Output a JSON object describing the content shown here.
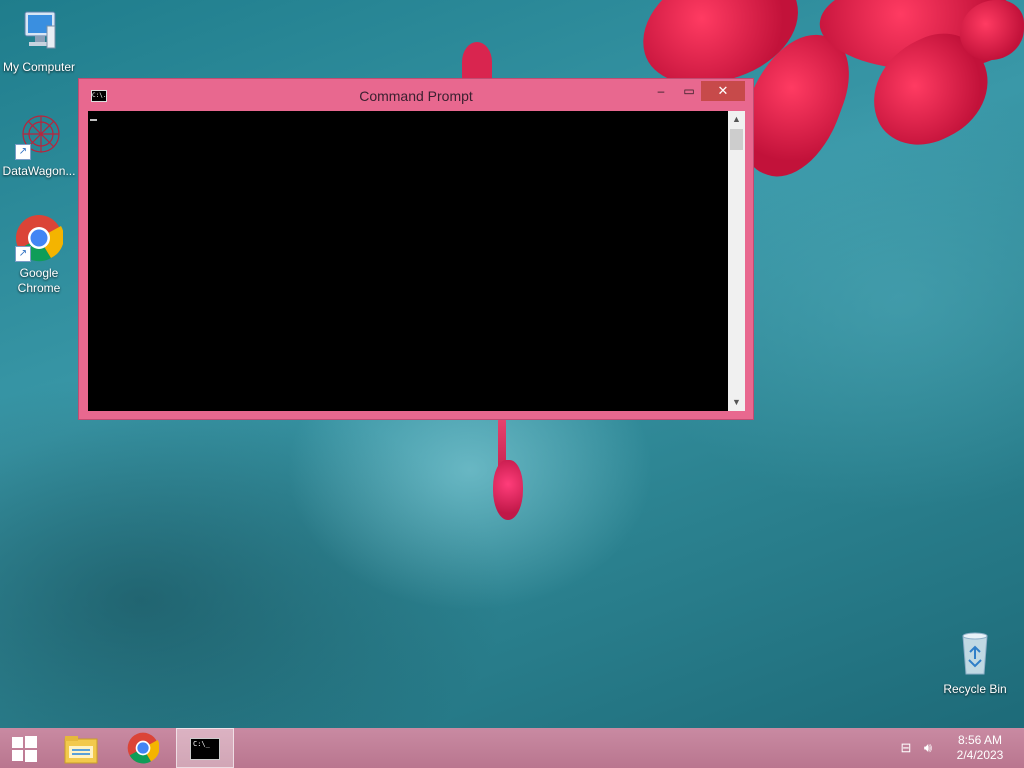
{
  "desktop": {
    "icons": [
      {
        "label": "My Computer"
      },
      {
        "label": "DataWagon..."
      },
      {
        "label": "Google Chrome"
      },
      {
        "label": "Recycle Bin"
      }
    ]
  },
  "window": {
    "title": "Command Prompt",
    "title_icon_text": "C:\\.",
    "minimize_glyph": "–",
    "maximize_glyph": "▭",
    "close_glyph": "✕"
  },
  "taskbar": {
    "cmd_icon_text": "C:\\_",
    "clock": {
      "time": "8:56 AM",
      "date": "2/4/2023"
    }
  },
  "colors": {
    "window_frame": "#e8688f",
    "close_button": "#c74a4a",
    "taskbar": "#c98aa2"
  }
}
